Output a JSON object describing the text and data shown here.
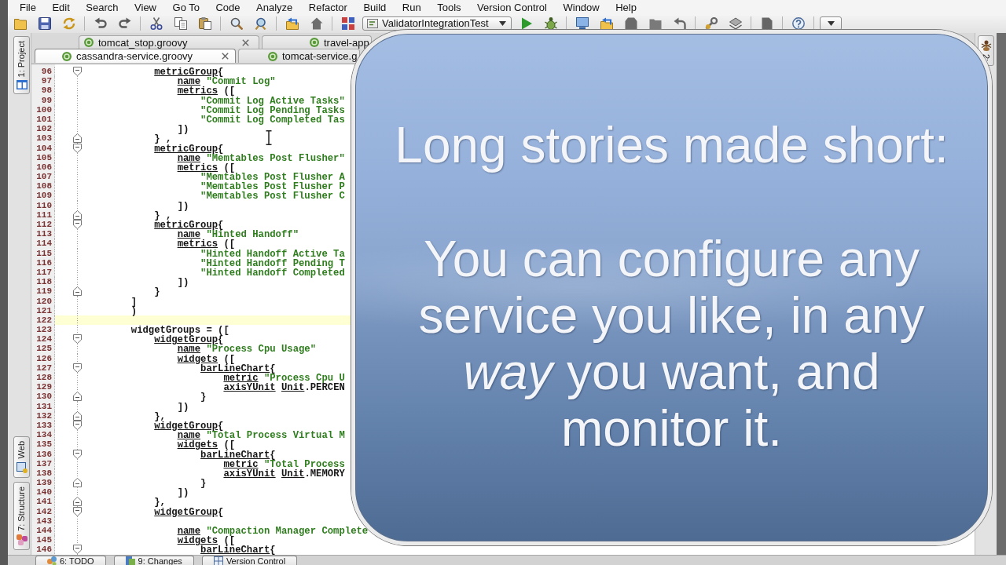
{
  "menu": [
    "File",
    "Edit",
    "Search",
    "View",
    "Go To",
    "Code",
    "Analyze",
    "Refactor",
    "Build",
    "Run",
    "Tools",
    "Version Control",
    "Window",
    "Help"
  ],
  "toolbar": {
    "run_configuration": "ValidatorIntegrationTest"
  },
  "tab_rows": [
    {
      "tabs": [
        {
          "label": "tomcat_stop.groovy",
          "selected": false,
          "closable": true
        },
        {
          "label": "travel-app",
          "selected": false,
          "closable": false
        }
      ]
    },
    {
      "tabs": [
        {
          "label": "cassandra-service.groovy",
          "selected": true,
          "closable": true
        },
        {
          "label": "tomcat-service.g",
          "selected": false,
          "closable": false
        }
      ]
    }
  ],
  "left_tool_tabs": [
    {
      "label": "1: Project"
    },
    {
      "label": "Web"
    },
    {
      "label": "7: Structure"
    }
  ],
  "right_tool_tabs": [
    {
      "label": "2:"
    }
  ],
  "editor": {
    "lines": [
      {
        "number": "96",
        "kind": "opener",
        "current": false,
        "tokens": [
          {
            "kind": "keyword",
            "text": "            metricGroup"
          },
          {
            "kind": "plain",
            "text": "{"
          }
        ]
      },
      {
        "number": "97",
        "kind": "plain",
        "current": false,
        "tokens": [
          {
            "kind": "keyword",
            "text": "                name"
          },
          {
            "kind": "string",
            "text": " \"Commit Log\""
          }
        ]
      },
      {
        "number": "98",
        "kind": "plain",
        "current": false,
        "tokens": [
          {
            "kind": "keyword",
            "text": "                metrics"
          },
          {
            "kind": "plain",
            "text": " (["
          }
        ]
      },
      {
        "number": "99",
        "kind": "plain",
        "current": false,
        "tokens": [
          {
            "kind": "string",
            "text": "                    \"Commit Log Active Tasks\""
          }
        ]
      },
      {
        "number": "100",
        "kind": "plain",
        "current": false,
        "tokens": [
          {
            "kind": "string",
            "text": "                    \"Commit Log Pending Tasks"
          }
        ]
      },
      {
        "number": "101",
        "kind": "plain",
        "current": false,
        "tokens": [
          {
            "kind": "string",
            "text": "                    \"Commit Log Completed Tas"
          }
        ]
      },
      {
        "number": "102",
        "kind": "plain",
        "current": false,
        "tokens": [
          {
            "kind": "plain",
            "text": "                ])"
          }
        ]
      },
      {
        "number": "103",
        "kind": "closer",
        "current": false,
        "tokens": [
          {
            "kind": "plain",
            "text": "            } ,"
          }
        ]
      },
      {
        "number": "104",
        "kind": "opener",
        "current": false,
        "tokens": [
          {
            "kind": "keyword",
            "text": "            metricGroup"
          },
          {
            "kind": "plain",
            "text": "{"
          }
        ]
      },
      {
        "number": "105",
        "kind": "plain",
        "current": false,
        "tokens": [
          {
            "kind": "keyword",
            "text": "                name"
          },
          {
            "kind": "string",
            "text": " \"Memtables Post Flusher\""
          }
        ]
      },
      {
        "number": "106",
        "kind": "plain",
        "current": false,
        "tokens": [
          {
            "kind": "keyword",
            "text": "                metrics"
          },
          {
            "kind": "plain",
            "text": " (["
          }
        ]
      },
      {
        "number": "107",
        "kind": "plain",
        "current": false,
        "tokens": [
          {
            "kind": "string",
            "text": "                    \"Memtables Post Flusher A"
          }
        ]
      },
      {
        "number": "108",
        "kind": "plain",
        "current": false,
        "tokens": [
          {
            "kind": "string",
            "text": "                    \"Memtables Post Flusher P"
          }
        ]
      },
      {
        "number": "109",
        "kind": "plain",
        "current": false,
        "tokens": [
          {
            "kind": "string",
            "text": "                    \"Memtables Post Flusher C"
          }
        ]
      },
      {
        "number": "110",
        "kind": "plain",
        "current": false,
        "tokens": [
          {
            "kind": "plain",
            "text": "                ])"
          }
        ]
      },
      {
        "number": "111",
        "kind": "closer",
        "current": false,
        "tokens": [
          {
            "kind": "plain",
            "text": "            } ,"
          }
        ]
      },
      {
        "number": "112",
        "kind": "opener",
        "current": false,
        "tokens": [
          {
            "kind": "keyword",
            "text": "            metricGroup"
          },
          {
            "kind": "plain",
            "text": "{"
          }
        ]
      },
      {
        "number": "113",
        "kind": "plain",
        "current": false,
        "tokens": [
          {
            "kind": "keyword",
            "text": "                name"
          },
          {
            "kind": "string",
            "text": " \"Hinted Handoff\""
          }
        ]
      },
      {
        "number": "114",
        "kind": "plain",
        "current": false,
        "tokens": [
          {
            "kind": "keyword",
            "text": "                metrics"
          },
          {
            "kind": "plain",
            "text": " (["
          }
        ]
      },
      {
        "number": "115",
        "kind": "plain",
        "current": false,
        "tokens": [
          {
            "kind": "string",
            "text": "                    \"Hinted Handoff Active Ta"
          }
        ]
      },
      {
        "number": "116",
        "kind": "plain",
        "current": false,
        "tokens": [
          {
            "kind": "string",
            "text": "                    \"Hinted Handoff Pending T"
          }
        ]
      },
      {
        "number": "117",
        "kind": "plain",
        "current": false,
        "tokens": [
          {
            "kind": "string",
            "text": "                    \"Hinted Handoff Completed"
          }
        ]
      },
      {
        "number": "118",
        "kind": "plain",
        "current": false,
        "tokens": [
          {
            "kind": "plain",
            "text": "                ])"
          }
        ]
      },
      {
        "number": "119",
        "kind": "closer",
        "current": false,
        "tokens": [
          {
            "kind": "plain",
            "text": "            }"
          }
        ]
      },
      {
        "number": "120",
        "kind": "plain",
        "current": false,
        "tokens": [
          {
            "kind": "plain",
            "text": "        ]"
          }
        ]
      },
      {
        "number": "121",
        "kind": "plain",
        "current": false,
        "tokens": [
          {
            "kind": "plain",
            "text": "        )"
          }
        ]
      },
      {
        "number": "122",
        "kind": "plain",
        "current": true
      },
      {
        "number": "123",
        "kind": "plain",
        "current": false,
        "tokens": [
          {
            "kind": "plain",
            "text": "        widgetGroups = (["
          }
        ]
      },
      {
        "number": "124",
        "kind": "opener",
        "current": false,
        "tokens": [
          {
            "kind": "keyword",
            "text": "            widgetGroup"
          },
          {
            "kind": "plain",
            "text": "{"
          }
        ]
      },
      {
        "number": "125",
        "kind": "plain",
        "current": false,
        "tokens": [
          {
            "kind": "keyword",
            "text": "                name"
          },
          {
            "kind": "string",
            "text": " \"Process Cpu Usage\""
          }
        ]
      },
      {
        "number": "126",
        "kind": "plain",
        "current": false,
        "tokens": [
          {
            "kind": "keyword",
            "text": "                widgets"
          },
          {
            "kind": "plain",
            "text": " (["
          }
        ]
      },
      {
        "number": "127",
        "kind": "opener",
        "current": false,
        "tokens": [
          {
            "kind": "keyword",
            "text": "                    barLineChart"
          },
          {
            "kind": "plain",
            "text": "{"
          }
        ]
      },
      {
        "number": "128",
        "kind": "plain",
        "current": false,
        "tokens": [
          {
            "kind": "keyword",
            "text": "                        metric"
          },
          {
            "kind": "string",
            "text": " \"Process Cpu U"
          }
        ]
      },
      {
        "number": "129",
        "kind": "plain",
        "current": false,
        "tokens": [
          {
            "kind": "keyword",
            "text": "                        axisYUnit"
          },
          {
            "kind": "keyword",
            "text": " Unit"
          },
          {
            "kind": "plain",
            "text": ".PERCEN"
          }
        ]
      },
      {
        "number": "130",
        "kind": "closer",
        "current": false,
        "tokens": [
          {
            "kind": "plain",
            "text": "                    }"
          }
        ]
      },
      {
        "number": "131",
        "kind": "plain",
        "current": false,
        "tokens": [
          {
            "kind": "plain",
            "text": "                ])"
          }
        ]
      },
      {
        "number": "132",
        "kind": "closer",
        "current": false,
        "tokens": [
          {
            "kind": "plain",
            "text": "            },"
          }
        ]
      },
      {
        "number": "133",
        "kind": "opener",
        "current": false,
        "tokens": [
          {
            "kind": "keyword",
            "text": "            widgetGroup"
          },
          {
            "kind": "plain",
            "text": "{"
          }
        ]
      },
      {
        "number": "134",
        "kind": "plain",
        "current": false,
        "tokens": [
          {
            "kind": "keyword",
            "text": "                name"
          },
          {
            "kind": "string",
            "text": " \"Total Process Virtual M"
          }
        ]
      },
      {
        "number": "135",
        "kind": "plain",
        "current": false,
        "tokens": [
          {
            "kind": "keyword",
            "text": "                widgets"
          },
          {
            "kind": "plain",
            "text": " (["
          }
        ]
      },
      {
        "number": "136",
        "kind": "opener",
        "current": false,
        "tokens": [
          {
            "kind": "keyword",
            "text": "                    barLineChart"
          },
          {
            "kind": "plain",
            "text": "{"
          }
        ]
      },
      {
        "number": "137",
        "kind": "plain",
        "current": false,
        "tokens": [
          {
            "kind": "keyword",
            "text": "                        metric"
          },
          {
            "kind": "string",
            "text": " \"Total Process"
          }
        ]
      },
      {
        "number": "138",
        "kind": "plain",
        "current": false,
        "tokens": [
          {
            "kind": "keyword",
            "text": "                        axisYUnit"
          },
          {
            "kind": "keyword",
            "text": " Unit"
          },
          {
            "kind": "plain",
            "text": ".MEMORY"
          }
        ]
      },
      {
        "number": "139",
        "kind": "closer",
        "current": false,
        "tokens": [
          {
            "kind": "plain",
            "text": "                    }"
          }
        ]
      },
      {
        "number": "140",
        "kind": "plain",
        "current": false,
        "tokens": [
          {
            "kind": "plain",
            "text": "                ])"
          }
        ]
      },
      {
        "number": "141",
        "kind": "closer",
        "current": false,
        "tokens": [
          {
            "kind": "plain",
            "text": "            },"
          }
        ]
      },
      {
        "number": "142",
        "kind": "opener",
        "current": false,
        "tokens": [
          {
            "kind": "keyword",
            "text": "            widgetGroup"
          },
          {
            "kind": "plain",
            "text": "{"
          }
        ]
      },
      {
        "number": "143",
        "kind": "plain",
        "current": false
      },
      {
        "number": "144",
        "kind": "plain",
        "current": false,
        "tokens": [
          {
            "kind": "keyword",
            "text": "                name"
          },
          {
            "kind": "string",
            "text": " \"Compaction Manager Complete"
          }
        ]
      },
      {
        "number": "145",
        "kind": "plain",
        "current": false,
        "tokens": [
          {
            "kind": "keyword",
            "text": "                widgets"
          },
          {
            "kind": "plain",
            "text": " (["
          }
        ]
      },
      {
        "number": "146",
        "kind": "opener",
        "current": false,
        "tokens": [
          {
            "kind": "keyword",
            "text": "                    barLineChart"
          },
          {
            "kind": "plain",
            "text": "{"
          }
        ]
      }
    ]
  },
  "bottom_tool_tabs": [
    {
      "label": "6: TODO"
    },
    {
      "label": "9: Changes"
    },
    {
      "label": "Version Control"
    }
  ],
  "callout": {
    "heading": "Long stories made short:",
    "body": "You can configure any service you like, in any *way* you want, and monitor it."
  }
}
